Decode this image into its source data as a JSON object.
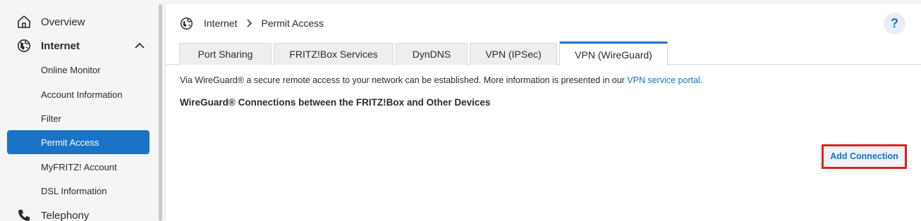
{
  "sidebar": {
    "items": [
      {
        "label": "Overview",
        "icon": "home-icon"
      },
      {
        "label": "Internet",
        "icon": "globe-icon"
      },
      {
        "label": "Telephony",
        "icon": "phone-icon"
      }
    ],
    "internet_sub": [
      {
        "label": "Online Monitor"
      },
      {
        "label": "Account Information"
      },
      {
        "label": "Filter"
      },
      {
        "label": "Permit Access"
      },
      {
        "label": "MyFRITZ! Account"
      },
      {
        "label": "DSL Information"
      }
    ],
    "active_item": "Permit Access"
  },
  "breadcrumb": {
    "parent": "Internet",
    "current": "Permit Access"
  },
  "help": {
    "label": "?"
  },
  "tabs": [
    {
      "label": "Port Sharing"
    },
    {
      "label": "FRITZ!Box Services"
    },
    {
      "label": "DynDNS"
    },
    {
      "label": "VPN (IPSec)"
    },
    {
      "label": "VPN (WireGuard)"
    }
  ],
  "active_tab": "VPN (WireGuard)",
  "content": {
    "intro_text": "Via WireGuard® a secure remote access to your network can be established. More information is presented in our",
    "intro_link": "VPN service portal",
    "intro_end": ".",
    "section_title": "WireGuard® Connections between the FRITZ!Box and Other Devices",
    "add_button": "Add Connection"
  },
  "colors": {
    "accent": "#1a73c7",
    "highlight_border": "#e0201f"
  }
}
